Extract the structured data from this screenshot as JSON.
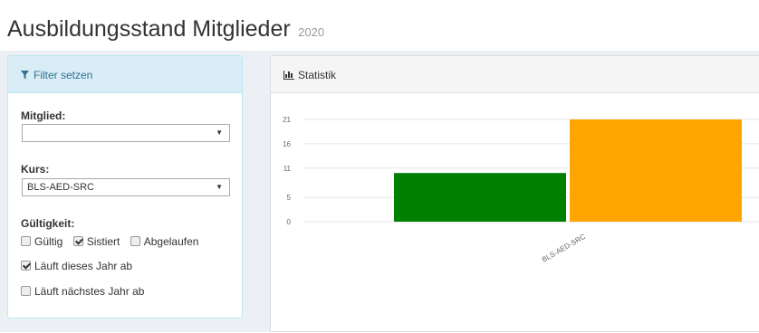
{
  "header": {
    "title": "Ausbildungsstand Mitglieder",
    "year": "2020"
  },
  "filter": {
    "heading": "Filter setzen",
    "mitglied": {
      "label": "Mitglied:",
      "value": ""
    },
    "kurs": {
      "label": "Kurs:",
      "value": "BLS-AED-SRC"
    },
    "gueltigkeit": {
      "label": "Gültigkeit:",
      "options": [
        {
          "label": "Gültig",
          "checked": false
        },
        {
          "label": "Sistiert",
          "checked": true
        },
        {
          "label": "Abgelaufen",
          "checked": false
        }
      ]
    },
    "laeuft_dieses_jahr": {
      "label": "Läuft dieses Jahr ab",
      "checked": true
    },
    "laeuft_naechstes_jahr": {
      "label": "Läuft nächstes Jahr ab",
      "checked": false
    }
  },
  "statistik": {
    "heading": "Statistik"
  },
  "chart_data": {
    "type": "bar",
    "categories": [
      "BLS-AED-SRC"
    ],
    "series": [
      {
        "values": [
          10
        ],
        "color": "#008000"
      },
      {
        "values": [
          21
        ],
        "color": "#ffa500"
      }
    ],
    "yticks": [
      0,
      5,
      11,
      16,
      21
    ],
    "ylim": [
      0,
      21
    ],
    "grid": true,
    "title": "",
    "xlabel": "",
    "ylabel": ""
  }
}
